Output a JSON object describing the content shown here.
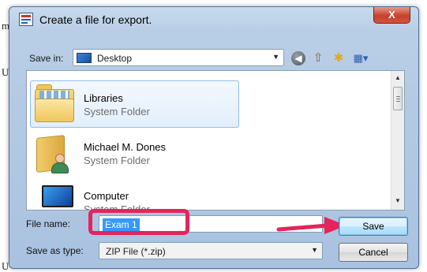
{
  "background_text": {
    "left_top": "m",
    "left_middle": "U",
    "left_bottom": "U"
  },
  "window": {
    "title": "Create a file for export.",
    "close_glyph": "X"
  },
  "toolbar": {
    "save_in_label": "Save in:",
    "save_in_value": "Desktop",
    "icons": [
      "back-icon",
      "up-one-level-icon",
      "new-folder-icon",
      "view-menu-icon"
    ]
  },
  "file_list": {
    "items": [
      {
        "name": "Libraries",
        "type": "System Folder",
        "icon": "libraries-folder-icon",
        "selected": true
      },
      {
        "name": "Michael M. Dones",
        "type": "System Folder",
        "icon": "user-folder-icon",
        "selected": false
      },
      {
        "name": "Computer",
        "type": "System Folder",
        "icon": "computer-icon",
        "selected": false
      }
    ]
  },
  "form": {
    "file_name_label": "File name:",
    "file_name_value": "Exam 1",
    "save_as_type_label": "Save as type:",
    "save_as_type_value": "ZIP File (*.zip)"
  },
  "buttons": {
    "save": "Save",
    "cancel": "Cancel"
  },
  "annotation": {
    "highlight_color": "#e5245c",
    "arrow_color": "#e5245c"
  }
}
